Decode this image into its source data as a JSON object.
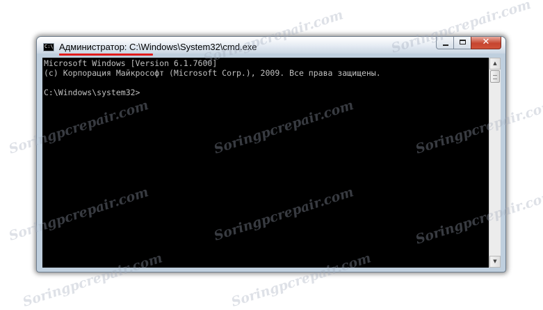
{
  "window": {
    "title_user": "Администратор:",
    "title_path": "C:\\Windows\\System32\\cmd.exe",
    "icon_text": "C:\\",
    "icon": "cmd-icon"
  },
  "controls": {
    "minimize_icon": "minimize-icon",
    "maximize_icon": "maximize-icon",
    "close_icon": "close-icon",
    "close_glyph": "✕"
  },
  "console": {
    "lines": [
      "Microsoft Windows [Version 6.1.7600]",
      "(c) Корпорация Майкрософт (Microsoft Corp.), 2009. Все права защищены.",
      "",
      "C:\\Windows\\system32>"
    ],
    "text_color": "#c0c0c0",
    "background": "#000000"
  },
  "scrollbar": {
    "up_glyph": "▲",
    "down_glyph": "▼"
  },
  "watermark": {
    "text": "Soringpcrepair.com"
  },
  "colors": {
    "highlight_underline": "#e21b1b",
    "close_button": "#c6452f"
  }
}
